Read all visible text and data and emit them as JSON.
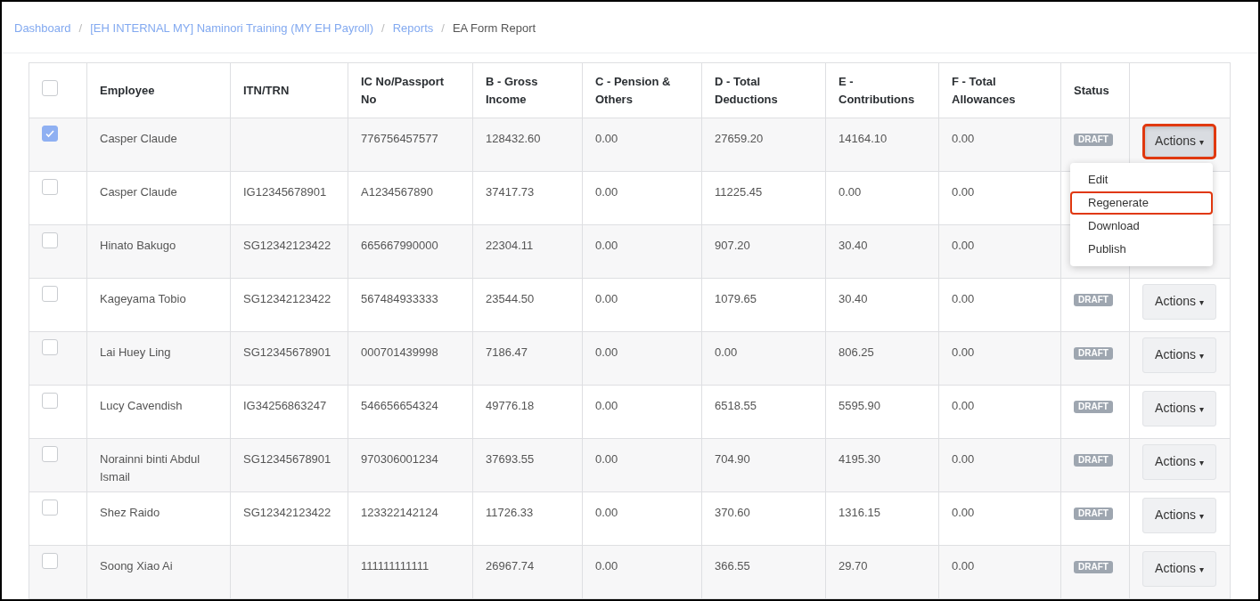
{
  "breadcrumb": [
    {
      "label": "Dashboard",
      "link": true
    },
    {
      "label": "[EH INTERNAL MY] Naminori Training (MY EH Payroll)",
      "link": true
    },
    {
      "label": "Reports",
      "link": true
    },
    {
      "label": "EA Form Report",
      "link": false
    }
  ],
  "breadcrumb_separator": "/",
  "table": {
    "select_all": {
      "checked": false
    },
    "columns": [
      "Employee",
      "ITN/TRN",
      "IC No/Passport No",
      "B - Gross Income",
      "C - Pension & Others",
      "D - Total Deductions",
      "E - Contributions",
      "F - Total Allowances",
      "Status"
    ],
    "rows": [
      {
        "checked": true,
        "cells": [
          "Casper Claude",
          "",
          "776756457577",
          "128432.60",
          "0.00",
          "27659.20",
          "14164.10",
          "0.00"
        ],
        "status": "DRAFT",
        "action": {
          "label": "Actions",
          "caret": "▾",
          "highlighted": true,
          "expanded": true
        }
      },
      {
        "checked": false,
        "cells": [
          "Casper Claude",
          "IG12345678901",
          "A1234567890",
          "37417.73",
          "0.00",
          "11225.45",
          "0.00",
          "0.00"
        ]
      },
      {
        "checked": false,
        "cells": [
          "Hinato Bakugo",
          "SG12342123422",
          "665667990000",
          "22304.11",
          "0.00",
          "907.20",
          "30.40",
          "0.00"
        ]
      },
      {
        "checked": false,
        "cells": [
          "Kageyama Tobio",
          "SG12342123422",
          "567484933333",
          "23544.50",
          "0.00",
          "1079.65",
          "30.40",
          "0.00"
        ],
        "status": "DRAFT",
        "action": {
          "label": "Actions",
          "caret": "▾",
          "highlighted": false,
          "expanded": false
        }
      },
      {
        "checked": false,
        "cells": [
          "Lai Huey Ling",
          "SG12345678901",
          "000701439998",
          "7186.47",
          "0.00",
          "0.00",
          "806.25",
          "0.00"
        ],
        "status": "DRAFT",
        "action": {
          "label": "Actions",
          "caret": "▾",
          "highlighted": false,
          "expanded": false
        }
      },
      {
        "checked": false,
        "cells": [
          "Lucy Cavendish",
          "IG34256863247",
          "546656654324",
          "49776.18",
          "0.00",
          "6518.55",
          "5595.90",
          "0.00"
        ],
        "status": "DRAFT",
        "action": {
          "label": "Actions",
          "caret": "▾",
          "highlighted": false,
          "expanded": false
        }
      },
      {
        "checked": false,
        "cells": [
          "Norainni binti Abdul Ismail",
          "SG12345678901",
          "970306001234",
          "37693.55",
          "0.00",
          "704.90",
          "4195.30",
          "0.00"
        ],
        "status": "DRAFT",
        "action": {
          "label": "Actions",
          "caret": "▾",
          "highlighted": false,
          "expanded": false
        }
      },
      {
        "checked": false,
        "cells": [
          "Shez Raido",
          "SG12342123422",
          "123322142124",
          "11726.33",
          "0.00",
          "370.60",
          "1316.15",
          "0.00"
        ],
        "status": "DRAFT",
        "action": {
          "label": "Actions",
          "caret": "▾",
          "highlighted": false,
          "expanded": false
        }
      },
      {
        "checked": false,
        "cells": [
          "Soong Xiao Ai",
          "",
          "111111111111",
          "26967.74",
          "0.00",
          "366.55",
          "29.70",
          "0.00"
        ],
        "status": "DRAFT",
        "action": {
          "label": "Actions",
          "caret": "▾",
          "highlighted": false,
          "expanded": false
        }
      }
    ]
  },
  "dropdown_menu": [
    {
      "label": "Edit",
      "highlighted": false
    },
    {
      "label": "Regenerate",
      "highlighted": true
    },
    {
      "label": "Download",
      "highlighted": false
    },
    {
      "label": "Publish",
      "highlighted": false
    }
  ]
}
